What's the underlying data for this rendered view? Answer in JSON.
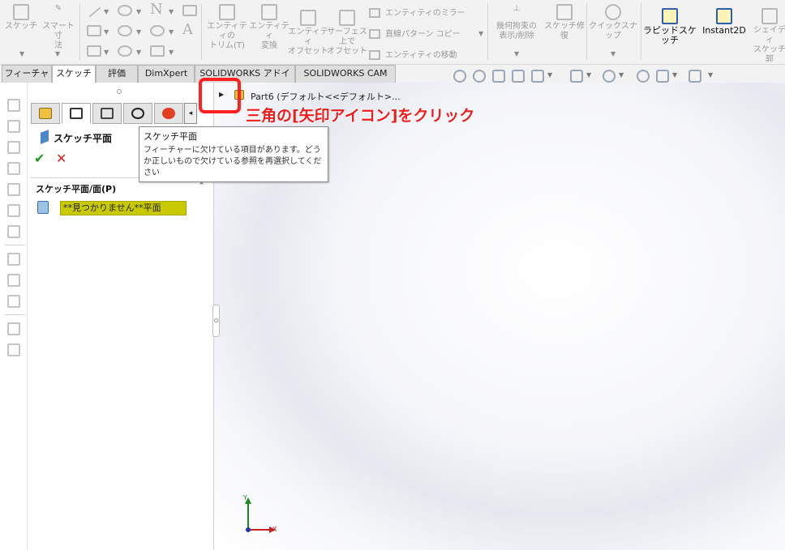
{
  "ribbon": {
    "sketch": "スケッチ",
    "smart_dim_1": "スマート寸",
    "smart_dim_2": "法",
    "trim_1": "エンティティの",
    "trim_2": "トリム(T)",
    "convert_1": "エンティティ",
    "convert_2": "変換",
    "offset_1": "エンティティ",
    "offset_2": "オフセット",
    "surface_offset_1": "サーフェス",
    "surface_offset_2": "上で",
    "surface_offset_3": "オフセット",
    "mirror": "エンティティのミラー",
    "linear_pattern": "直線パターン コピー",
    "move": "エンティティの移動",
    "relations_1": "幾何拘束の",
    "relations_2": "表示/削除",
    "repair_1": "スケッチ修",
    "repair_2": "復",
    "quick_snap": "クイックスナップ",
    "rapid_sketch": "ラピッドスケッチ",
    "instant2d": "Instant2D",
    "shaded_1": "シェイディ",
    "shaded_2": "スケッチ",
    "shaded_3": "郭"
  },
  "tabs": [
    "フィーチャー",
    "スケッチ",
    "評価",
    "DimXpert",
    "SOLIDWORKS アドイン",
    "SOLIDWORKS CAM"
  ],
  "panel": {
    "title": "スケッチ平面",
    "ok": "✔",
    "cancel": "✕",
    "section_title": "スケッチ平面/面(P)",
    "plane_value": "**見つかりません**平面",
    "collapse": "◂"
  },
  "tooltip": {
    "title": "スケッチ平面",
    "body": "フィーチャーに欠けている項目があります。どうか正しいもので欠けている参照を再選択してください"
  },
  "tree": {
    "part_label": "Part6 (デフォルト<<デフォルト>..."
  },
  "annotation": "三角の[矢印アイコン]をクリック",
  "triad": {
    "y": "Y",
    "x": "X"
  },
  "colors": {
    "highlight": "#ff2020",
    "annotation": "#ee1d1d",
    "plane_field": "#c9c900"
  }
}
